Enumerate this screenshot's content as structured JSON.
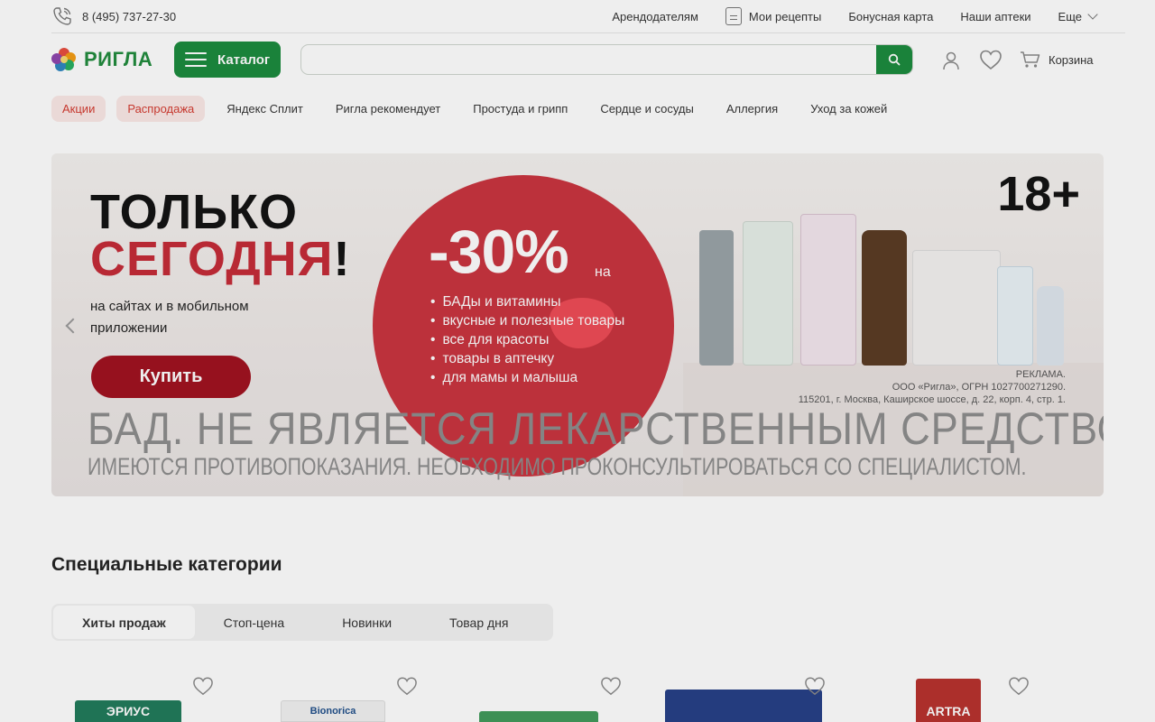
{
  "topbar": {
    "phone": "8 (495) 737-27-30",
    "links": [
      "Арендодателям",
      "Мои рецепты",
      "Бонусная карта",
      "Наши аптеки",
      "Еще"
    ]
  },
  "header": {
    "logo_text": "РИГЛА",
    "catalog_label": "Каталог",
    "search_placeholder": "",
    "cart_label": "Корзина"
  },
  "nav": {
    "pills": [
      "Акции",
      "Распродажа"
    ],
    "items": [
      "Яндекс Сплит",
      "Ригла рекомендует",
      "Простуда и грипп",
      "Сердце и сосуды",
      "Аллергия",
      "Уход за кожей"
    ]
  },
  "banner": {
    "title_line1": "ТОЛЬКО",
    "title_line2": "СЕГОДНЯ",
    "title_bang": "!",
    "subtitle": "на сайтах и в мобильном приложении",
    "buy_label": "Купить",
    "discount": "-30%",
    "discount_suffix": "на",
    "bullets": [
      "БАДы и витамины",
      "вкусные и полезные товары",
      "все для красоты",
      "товары в аптечку",
      "для мамы и малыша"
    ],
    "age": "18+",
    "ad_lines": [
      "РЕКЛАМА.",
      "ООО «Ригла», ОГРН 1027700271290.",
      "115201, г. Москва, Каширское шоссе, д. 22, корп. 4, стр. 1."
    ],
    "warning_line1": "БАД. НЕ ЯВЛЯЕТСЯ ЛЕКАРСТВЕННЫМ СРЕДСТВОМ",
    "warning_line2": "ИМЕЮТСЯ ПРОТИВОПОКАЗАНИЯ. НЕОБХОДИМО ПРОКОНСУЛЬТИРОВАТЬСЯ СО СПЕЦИАЛИСТОМ."
  },
  "special": {
    "title": "Специальные категории",
    "tabs": [
      "Хиты продаж",
      "Стоп-цена",
      "Новинки",
      "Товар дня"
    ]
  },
  "products": [
    {
      "pack_text": "ЭРИУС"
    },
    {
      "pack_text": "Bionorica"
    },
    {
      "pack_text": ""
    },
    {
      "pack_text": ""
    },
    {
      "pack_text": "ARTRA"
    }
  ],
  "colors": {
    "brand_green": "#1a8a3c",
    "promo_red": "#c9323d",
    "buy_red": "#a0101e"
  }
}
